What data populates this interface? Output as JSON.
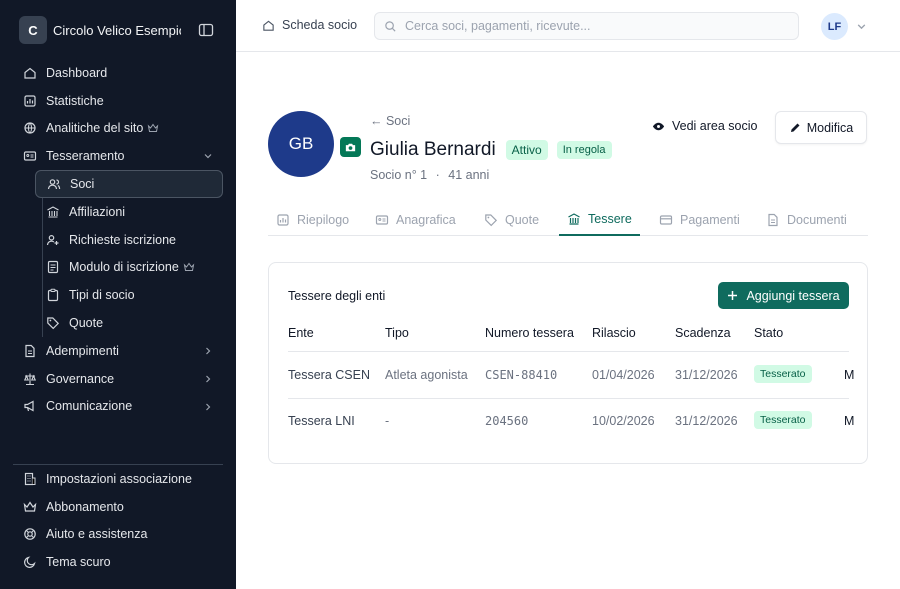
{
  "org": {
    "initial": "C",
    "name": "Circolo Velico Esempio"
  },
  "sidebar": {
    "items": [
      {
        "label": "Dashboard",
        "icon": "home-icon"
      },
      {
        "label": "Statistiche",
        "icon": "chart-icon"
      },
      {
        "label": "Analitiche del sito",
        "icon": "analytics-icon",
        "premium": true
      },
      {
        "label": "Tesseramento",
        "icon": "card-icon",
        "expanded": true
      }
    ],
    "subitems": [
      {
        "label": "Soci",
        "icon": "users-icon",
        "active": true
      },
      {
        "label": "Affiliazioni",
        "icon": "building-icon"
      },
      {
        "label": "Richieste iscrizione",
        "icon": "user-plus-icon"
      },
      {
        "label": "Modulo di iscrizione",
        "icon": "form-icon",
        "premium": true
      },
      {
        "label": "Tipi di socio",
        "icon": "clipboard-icon"
      },
      {
        "label": "Quote",
        "icon": "tag-icon"
      }
    ],
    "groups": [
      {
        "label": "Adempimenti",
        "icon": "file-icon"
      },
      {
        "label": "Governance",
        "icon": "scale-icon"
      },
      {
        "label": "Comunicazione",
        "icon": "megaphone-icon"
      }
    ],
    "bottom": [
      {
        "label": "Impostazioni associazione",
        "icon": "building-settings-icon"
      },
      {
        "label": "Abbonamento",
        "icon": "crown-icon"
      },
      {
        "label": "Aiuto e assistenza",
        "icon": "lifebuoy-icon"
      },
      {
        "label": "Tema scuro",
        "icon": "moon-icon"
      }
    ]
  },
  "topbar": {
    "breadcrumb": "Scheda socio",
    "search_placeholder": "Cerca soci, pagamenti, ricevute...",
    "user_initials": "LF"
  },
  "profile": {
    "initials": "GB",
    "back_label": "← Soci",
    "name": "Giulia Bernardi",
    "status": "Attivo",
    "payment_status": "In regola",
    "member_number": "Socio n° 1",
    "separator": "·",
    "age": "41 anni",
    "view_label": "Vedi area socio",
    "edit_label": "Modifica"
  },
  "tabs": [
    {
      "label": "Riepilogo",
      "icon": "chart-icon"
    },
    {
      "label": "Anagrafica",
      "icon": "id-card-icon"
    },
    {
      "label": "Quote",
      "icon": "tag-icon"
    },
    {
      "label": "Tessere",
      "icon": "building-icon",
      "active": true
    },
    {
      "label": "Pagamenti",
      "icon": "credit-card-icon"
    },
    {
      "label": "Documenti",
      "icon": "file-icon"
    }
  ],
  "cards_section": {
    "title": "Tessere degli enti",
    "add_label": "Aggiungi tessera",
    "columns": [
      "Ente",
      "Tipo",
      "Numero tessera",
      "Rilascio",
      "Scadenza",
      "Stato"
    ],
    "rows": [
      {
        "ente": "Tessera CSEN",
        "tipo": "Atleta agonista",
        "numero": "CSEN-88410",
        "rilascio": "01/04/2026",
        "scadenza": "31/12/2026",
        "stato": "Tesserato",
        "next": "M"
      },
      {
        "ente": "Tessera LNI",
        "tipo": "-",
        "numero": "204560",
        "rilascio": "10/02/2026",
        "scadenza": "31/12/2026",
        "stato": "Tesserato",
        "next": "M"
      }
    ]
  },
  "colors": {
    "sidebar_bg": "#111827",
    "accent": "#0f6b5e",
    "avatar": "#1e3a8a",
    "success_bg": "#d1fae5"
  }
}
